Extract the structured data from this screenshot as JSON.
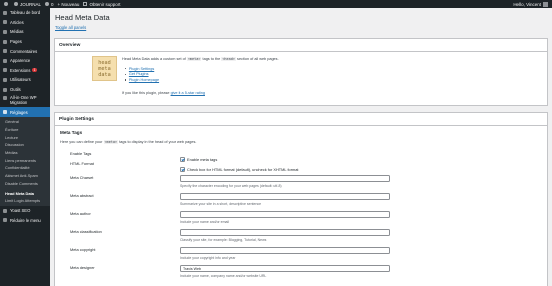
{
  "adminbar": {
    "site_name": "JOURNAL",
    "comments_count": "0",
    "new_label": "+ Nouveau",
    "extension_label": "Obtenir support",
    "howdy": "Hello, Vincent"
  },
  "sidebar": {
    "items": [
      {
        "label": "Tableau de bord"
      },
      {
        "label": "Articles"
      },
      {
        "label": "Médias"
      },
      {
        "label": "Pages"
      },
      {
        "label": "Commentaires"
      },
      {
        "label": "Apparence"
      },
      {
        "label": "Extensions",
        "badge": "1"
      },
      {
        "label": "Utilisateurs"
      },
      {
        "label": "Outils"
      },
      {
        "label": "All-in-One WP Migration"
      },
      {
        "label": "Réglages"
      }
    ],
    "submenu": [
      {
        "label": "Général"
      },
      {
        "label": "Écriture"
      },
      {
        "label": "Lecture"
      },
      {
        "label": "Discussion"
      },
      {
        "label": "Médias"
      },
      {
        "label": "Liens permanents"
      },
      {
        "label": "Confidentialité"
      },
      {
        "label": "Akismet Anti-Spam"
      },
      {
        "label": "Disable Comments"
      },
      {
        "label": "Head Meta Data",
        "current": true
      },
      {
        "label": "Limit Login Attempts"
      }
    ],
    "bottom_items": [
      {
        "label": "Yoast SEO"
      },
      {
        "label": "Réduire le menu"
      }
    ]
  },
  "page": {
    "title": "Head Meta Data",
    "back_link": "Toggle all panels"
  },
  "overview": {
    "heading": "Overview",
    "logo_lines": [
      "head",
      "meta",
      "data"
    ],
    "description_start": "Head Meta Data adds a custom set of",
    "code1": "<meta>",
    "description_mid": "tags to the",
    "code2": "<head>",
    "description_end": "section of all web pages.",
    "links": [
      "Plugin Settings",
      "Get Plugins",
      "Plugin Homepage"
    ],
    "rate_text": "If you like this plugin, please",
    "rate_link": "give it a 5-star rating"
  },
  "settings": {
    "heading": "Plugin Settings",
    "section_title": "Meta Tags",
    "section_desc_start": "Here you can define your",
    "section_desc_code": "<meta>",
    "section_desc_end": "tags to display in the head of your web pages.",
    "rows": [
      {
        "label": "Enable Tags",
        "type": "checkbox",
        "checked": true,
        "text": "Enable meta tags"
      },
      {
        "label": "HTML Format",
        "type": "checkbox",
        "checked": true,
        "text": "Check box for HTML format (default), uncheck for XHTML format"
      },
      {
        "label": "Meta Charset",
        "type": "text",
        "value": "",
        "desc": "Specify the character encoding for your web pages (default: utf-8)"
      },
      {
        "label": "Meta abstract",
        "type": "text",
        "value": "",
        "desc": "Summarize your site in a short, descriptive sentence"
      },
      {
        "label": "Meta author",
        "type": "text",
        "value": "",
        "desc": "Include your name and/or email"
      },
      {
        "label": "Meta classification",
        "type": "text",
        "value": "",
        "desc": "Classify your site, for example: Blogging, Tutorial, News"
      },
      {
        "label": "Meta copyright",
        "type": "text",
        "value": "",
        "desc": "Include your copyright info and year"
      },
      {
        "label": "Meta designer",
        "type": "text",
        "value": "Travis Web",
        "desc": "Include your name, company name and/or website URL"
      }
    ]
  }
}
